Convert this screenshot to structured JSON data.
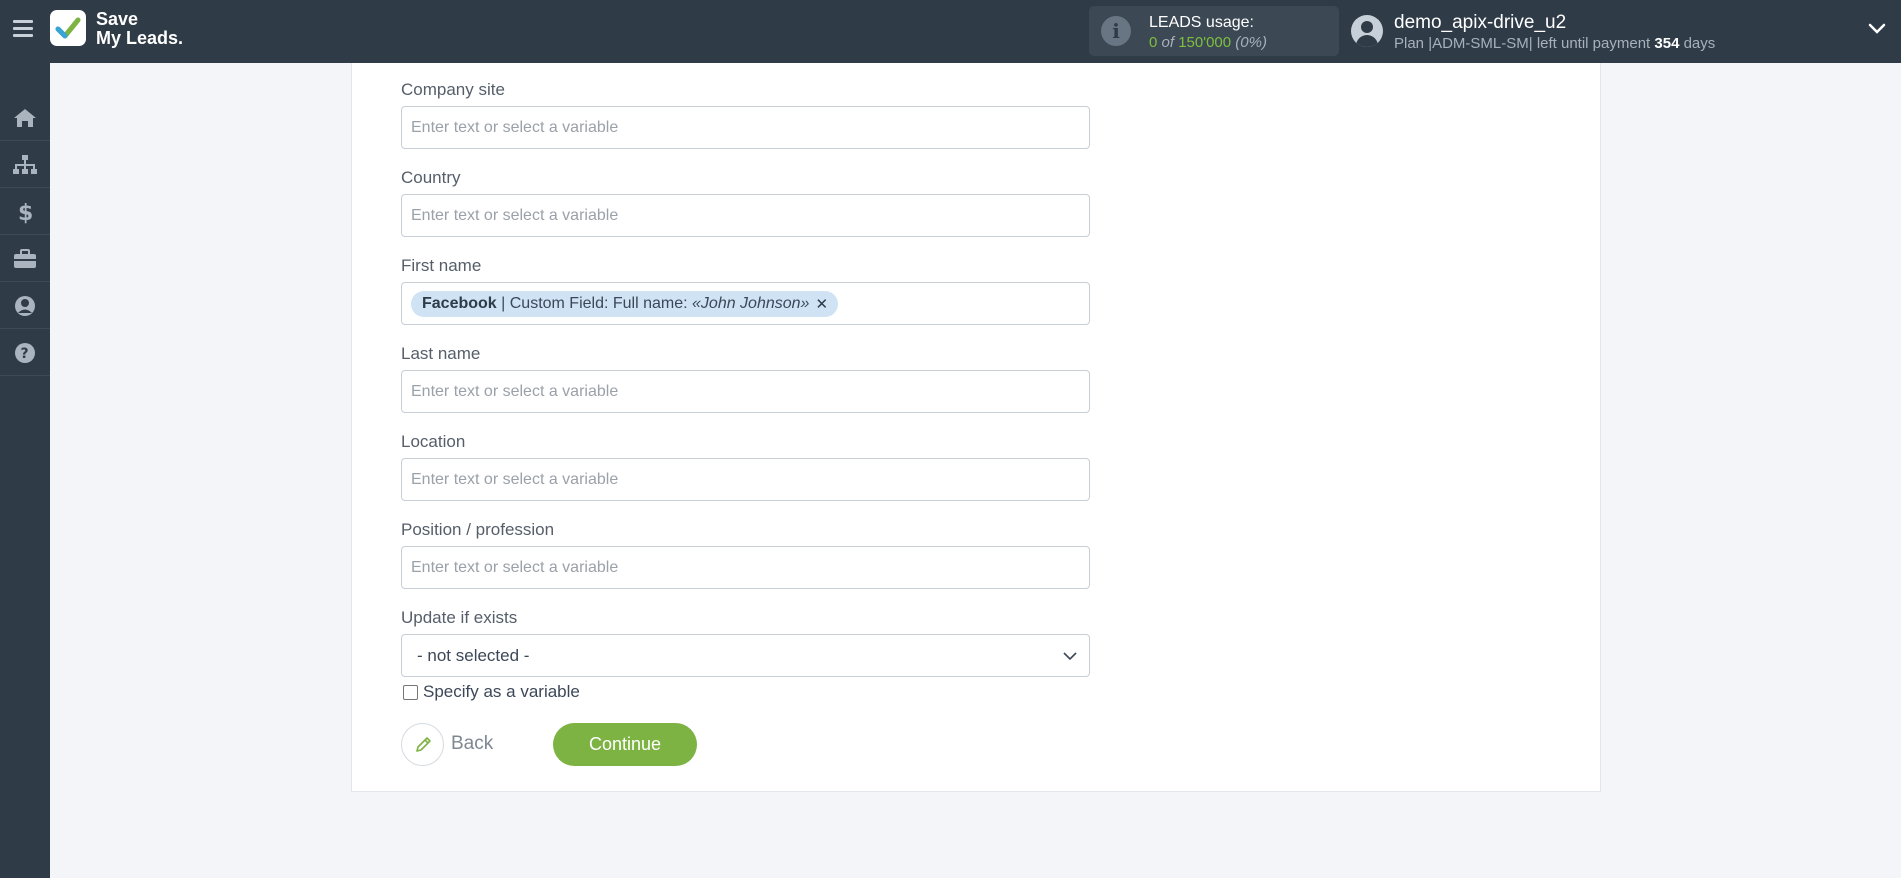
{
  "brand": {
    "line1": "Save",
    "line2": "My Leads."
  },
  "leads": {
    "label": "LEADS usage:",
    "used": "0",
    "of_word": "of",
    "total": "150'000",
    "percent": "(0%)"
  },
  "user": {
    "name": "demo_apix-drive_u2",
    "plan_prefix": "Plan |ADM-SML-SM| left until payment",
    "days": "354",
    "days_suffix": "days"
  },
  "form": {
    "fields": [
      {
        "label": "Company site",
        "placeholder": "Enter text or select a variable"
      },
      {
        "label": "Country",
        "placeholder": "Enter text or select a variable"
      },
      {
        "label": "First name",
        "chip": {
          "source": "Facebook",
          "field": " | Custom Field: Full name: ",
          "value": "«John Johnson»"
        }
      },
      {
        "label": "Last name",
        "placeholder": "Enter text or select a variable"
      },
      {
        "label": "Location",
        "placeholder": "Enter text or select a variable"
      },
      {
        "label": "Position / profession",
        "placeholder": "Enter text or select a variable"
      }
    ],
    "update": {
      "label": "Update if exists",
      "selected": "- not selected -"
    },
    "specify_label": "Specify as a variable",
    "back_label": "Back",
    "continue_label": "Continue"
  },
  "colors": {
    "topbar": "#2f3b47",
    "accent_green": "#7cb342",
    "chip_bg": "#cfe3f5"
  },
  "icons": [
    "menu-icon",
    "logo-check-icon",
    "info-icon",
    "user-avatar-icon",
    "chevron-down-icon",
    "home-icon",
    "sitemap-icon",
    "dollar-icon",
    "briefcase-icon",
    "user-circle-icon",
    "help-icon",
    "pencil-icon"
  ]
}
